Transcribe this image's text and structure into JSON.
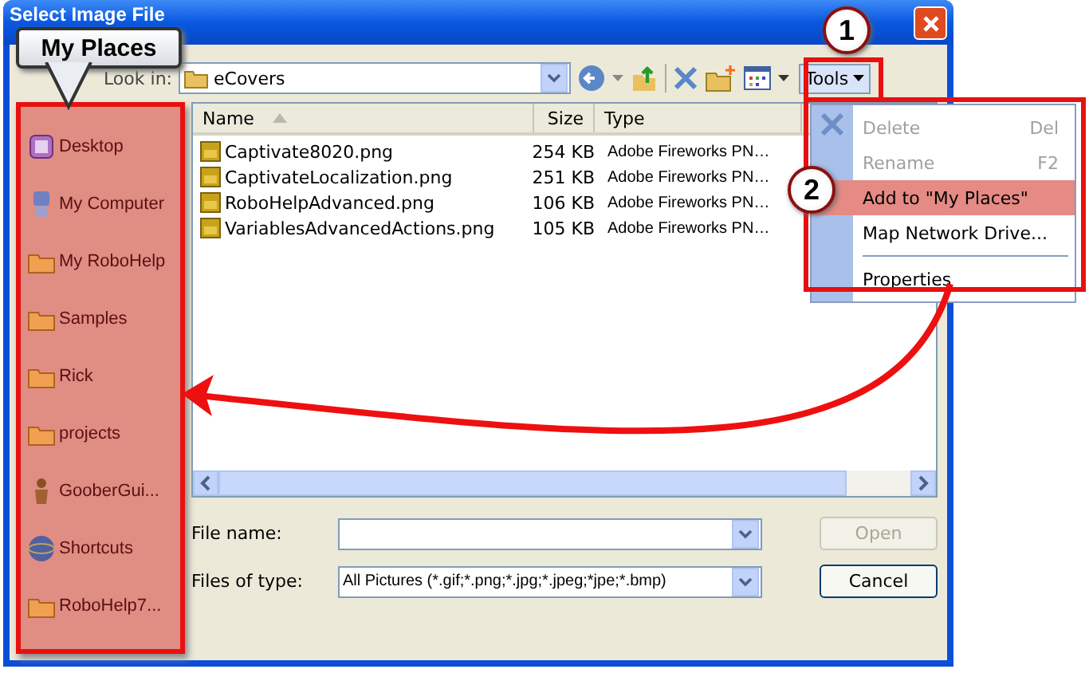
{
  "window": {
    "title": "Select Image File"
  },
  "callout": {
    "text": "My Places"
  },
  "look_in": {
    "label": "Look in:",
    "value": "eCovers"
  },
  "tools_button": {
    "label": "Tools"
  },
  "places": [
    {
      "label": "Desktop",
      "kind": "desktop"
    },
    {
      "label": "My Computer",
      "kind": "computer"
    },
    {
      "label": "My RoboHelp",
      "kind": "folder"
    },
    {
      "label": "Samples",
      "kind": "folder"
    },
    {
      "label": "Rick",
      "kind": "folder"
    },
    {
      "label": "projects",
      "kind": "folder"
    },
    {
      "label": "GooberGui...",
      "kind": "figure"
    },
    {
      "label": "Shortcuts",
      "kind": "globe"
    },
    {
      "label": "RoboHelp7...",
      "kind": "folder"
    }
  ],
  "table": {
    "columns": [
      {
        "label": "Name",
        "sorted": true
      },
      {
        "label": "Size",
        "sorted": false
      },
      {
        "label": "Type",
        "sorted": false
      }
    ],
    "rows": [
      {
        "name": "Captivate8020.png",
        "size": "254 KB",
        "type": "Adobe Fireworks PN…"
      },
      {
        "name": "CaptivateLocalization.png",
        "size": "251 KB",
        "type": "Adobe Fireworks PN…"
      },
      {
        "name": "RoboHelpAdvanced.png",
        "size": "106 KB",
        "type": "Adobe Fireworks PN…"
      },
      {
        "name": "VariablesAdvancedActions.png",
        "size": "105 KB",
        "type": "Adobe Fireworks PN…"
      }
    ]
  },
  "menu": [
    {
      "label": "Delete",
      "shortcut": "Del",
      "disabled": true,
      "selected": false,
      "kind": "item"
    },
    {
      "label": "Rename",
      "shortcut": "F2",
      "disabled": true,
      "selected": false,
      "kind": "item"
    },
    {
      "label": "Add to \"My Places\"",
      "disabled": false,
      "selected": true,
      "kind": "item"
    },
    {
      "label": "Map Network Drive...",
      "disabled": false,
      "selected": false,
      "kind": "item"
    },
    {
      "kind": "separator"
    },
    {
      "label": "Properties",
      "disabled": false,
      "selected": false,
      "kind": "item"
    }
  ],
  "file_name": {
    "label": "File name:"
  },
  "file_type": {
    "label": "Files of type:",
    "value": "All Pictures (*.gif;*.png;*.jpg;*.jpeg;*jpe;*.bmp)"
  },
  "buttons": [
    {
      "label": "Open",
      "disabled": true
    },
    {
      "label": "Cancel",
      "disabled": false
    }
  ],
  "step_markers": [
    "1",
    "2"
  ]
}
